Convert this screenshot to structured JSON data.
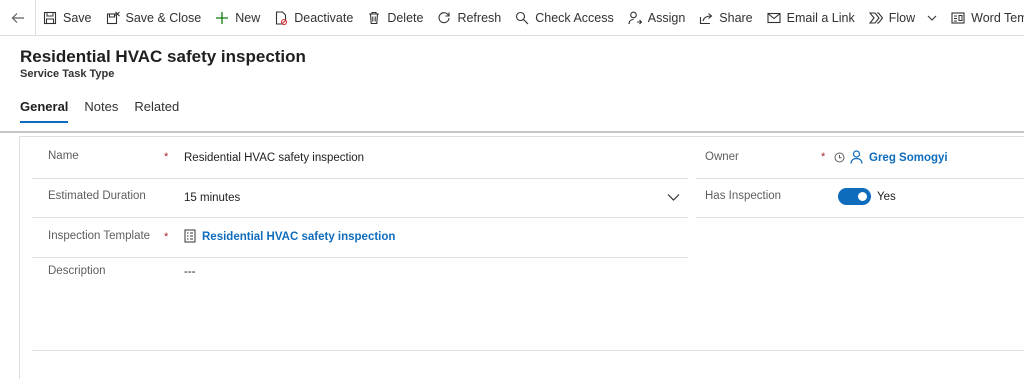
{
  "commands": {
    "save": "Save",
    "save_close": "Save & Close",
    "new": "New",
    "deactivate": "Deactivate",
    "delete": "Delete",
    "refresh": "Refresh",
    "check_access": "Check Access",
    "assign": "Assign",
    "share": "Share",
    "email_link": "Email a Link",
    "flow": "Flow",
    "word_templates": "Word Templates"
  },
  "header": {
    "title": "Residential HVAC safety inspection",
    "subtitle": "Service Task Type"
  },
  "tabs": [
    {
      "label": "General",
      "active": true
    },
    {
      "label": "Notes",
      "active": false
    },
    {
      "label": "Related",
      "active": false
    }
  ],
  "form": {
    "name": {
      "label": "Name",
      "required": "*",
      "value": "Residential HVAC safety inspection"
    },
    "estimated_duration": {
      "label": "Estimated Duration",
      "value": "15 minutes"
    },
    "inspection_template": {
      "label": "Inspection Template",
      "required": "*",
      "value": "Residential HVAC safety inspection"
    },
    "description": {
      "label": "Description",
      "value": "---"
    },
    "owner": {
      "label": "Owner",
      "required": "*",
      "value": "Greg Somogyi"
    },
    "has_inspection": {
      "label": "Has Inspection",
      "value": "Yes",
      "on": true
    }
  },
  "colors": {
    "accent": "#0f6cbd",
    "required": "#a4262c"
  }
}
